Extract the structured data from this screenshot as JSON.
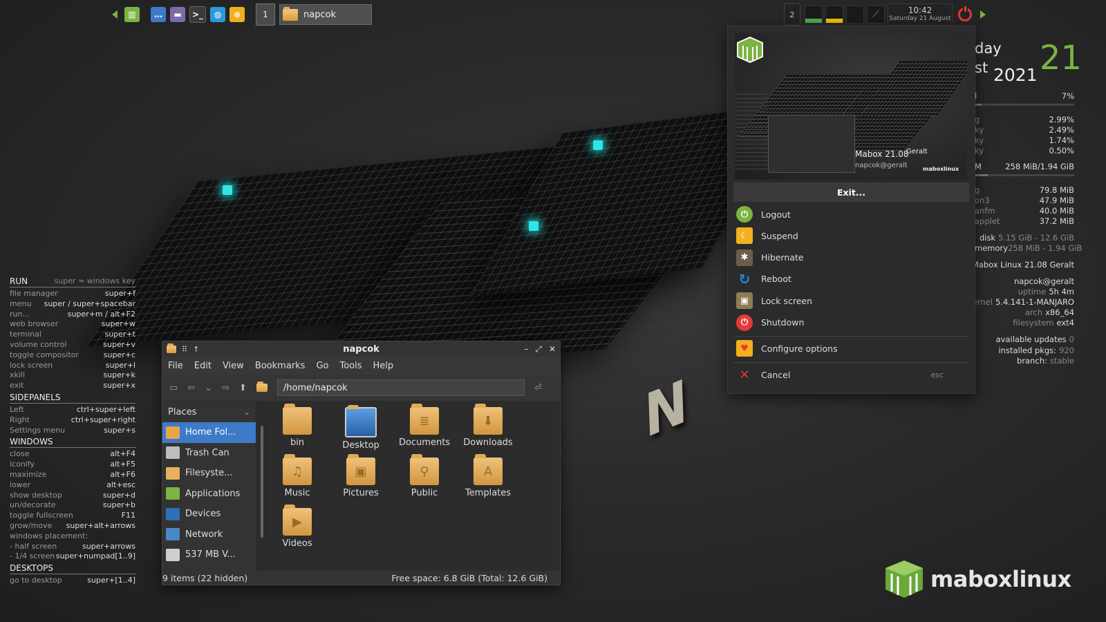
{
  "panel": {
    "workspace_current": "1",
    "task_title": "napcok",
    "workspace_right": "2",
    "clock_time": "10:42",
    "clock_date": "Saturday 21 August"
  },
  "keybinds": {
    "run_header": "RUN",
    "run_sub": "super = windows key",
    "run": [
      {
        "label": "file manager",
        "key": "super+f"
      },
      {
        "label": "menu",
        "key": "super / super+spacebar"
      },
      {
        "label": "run...",
        "key": "super+m / alt+F2"
      },
      {
        "label": "web browser",
        "key": "super+w"
      },
      {
        "label": "terminal",
        "key": "super+t"
      },
      {
        "label": "volume control",
        "key": "super+v"
      },
      {
        "label": "toggle compositor",
        "key": "super+c"
      },
      {
        "label": "lock screen",
        "key": "super+l"
      },
      {
        "label": "xkill",
        "key": "super+k"
      },
      {
        "label": "exit",
        "key": "super+x"
      }
    ],
    "sidepanels_header": "SIDEPANELS",
    "sidepanels": [
      {
        "label": "Left",
        "key": "ctrl+super+left"
      },
      {
        "label": "Right",
        "key": "ctrl+super+right"
      },
      {
        "label": "Settings menu",
        "key": "super+s"
      }
    ],
    "windows_header": "WINDOWS",
    "windows": [
      {
        "label": "close",
        "key": "alt+F4"
      },
      {
        "label": "iconify",
        "key": "alt+F5"
      },
      {
        "label": "maximize",
        "key": "alt+F6"
      },
      {
        "label": "lower",
        "key": "alt+esc"
      },
      {
        "label": "show desktop",
        "key": "super+d"
      },
      {
        "label": "un/decorate",
        "key": "super+b"
      },
      {
        "label": "toggle fullscreen",
        "key": "F11"
      },
      {
        "label": "grow/move",
        "key": "super+alt+arrows"
      },
      {
        "label": "windows placement:",
        "key": ""
      },
      {
        "label": " - half screen",
        "key": "super+arrows"
      },
      {
        "label": " - 1/4 screen",
        "key": "super+numpad[1..9]"
      }
    ],
    "desktops_header": "DESKTOPS",
    "desktops": [
      {
        "label": "go to desktop",
        "key": "super+[1..4]"
      }
    ]
  },
  "file_manager": {
    "title": "napcok",
    "menu": [
      "File",
      "Edit",
      "View",
      "Bookmarks",
      "Go",
      "Tools",
      "Help"
    ],
    "path": "/home/napcok",
    "places_label": "Places",
    "places": [
      {
        "label": "Home Fol...",
        "icon": "home-folder-icon",
        "color": "#e8a64a",
        "selected": true
      },
      {
        "label": "Trash Can",
        "icon": "trash-icon",
        "color": "#bdbdbd",
        "selected": false
      },
      {
        "label": "Filesyste...",
        "icon": "folder-icon",
        "color": "#e8b25c",
        "selected": false
      },
      {
        "label": "Applications",
        "icon": "applications-icon",
        "color": "#7cb342",
        "selected": false
      },
      {
        "label": "Devices",
        "icon": "monitor-icon",
        "color": "#2f6fb8",
        "selected": false
      },
      {
        "label": "Network",
        "icon": "network-icon",
        "color": "#4a86c8",
        "selected": false
      },
      {
        "label": "537 MB V...",
        "icon": "drive-icon",
        "color": "#cfcfcf",
        "selected": false
      }
    ],
    "files": [
      {
        "name": "bin",
        "icon": "folder-icon",
        "glyph": ""
      },
      {
        "name": "Desktop",
        "icon": "desktop-folder-icon",
        "glyph": ""
      },
      {
        "name": "Documents",
        "icon": "documents-folder-icon",
        "glyph": "≣"
      },
      {
        "name": "Downloads",
        "icon": "downloads-folder-icon",
        "glyph": "⬇"
      },
      {
        "name": "Music",
        "icon": "music-folder-icon",
        "glyph": "♫"
      },
      {
        "name": "Pictures",
        "icon": "pictures-folder-icon",
        "glyph": "▣"
      },
      {
        "name": "Public",
        "icon": "public-folder-icon",
        "glyph": "⚲"
      },
      {
        "name": "Templates",
        "icon": "templates-folder-icon",
        "glyph": "A"
      },
      {
        "name": "Videos",
        "icon": "videos-folder-icon",
        "glyph": "▶"
      }
    ],
    "status_items": "9 items (22 hidden)",
    "status_free": "Free space: 6.8 GiB (Total: 12.6 GiB)"
  },
  "exit_dialog": {
    "preview_name": "Mabox 21.08",
    "preview_codename": "Geralt",
    "preview_user": "napcok@geralt",
    "preview_brand": "maboxlinux",
    "exit_label": "Exit...",
    "options": [
      {
        "label": "Logout",
        "icon": "logout-icon",
        "color": "#7cb342",
        "glyph": "⏻"
      },
      {
        "label": "Suspend",
        "icon": "suspend-icon",
        "color": "#f2b01e",
        "glyph": "☾"
      },
      {
        "label": "Hibernate",
        "icon": "hibernate-icon",
        "color": "#6d5d4f",
        "glyph": "✱"
      },
      {
        "label": "Reboot",
        "icon": "reboot-icon",
        "color": "#1e88e5",
        "glyph": "↻"
      },
      {
        "label": "Lock screen",
        "icon": "lock-icon",
        "color": "#8a7d55",
        "glyph": "▣"
      },
      {
        "label": "Shutdown",
        "icon": "shutdown-icon",
        "color": "#e53935",
        "glyph": "⏻"
      }
    ],
    "configure_label": "Configure options",
    "cancel_label": "Cancel",
    "cancel_key": "esc"
  },
  "conky": {
    "day_partial": "day",
    "month_partial": "st",
    "year": "2021",
    "day_num": "21",
    "cpu_pct": "7%",
    "cpu_pct_value": 0.07,
    "procs_cpu": [
      {
        "name": "g",
        "val": "2.99%"
      },
      {
        "name": "ky",
        "val": "2.49%"
      },
      {
        "name": "ky",
        "val": "1.74%"
      },
      {
        "name": "ky",
        "val": "0.50%"
      }
    ],
    "mem_label": "M",
    "mem_val": "258 MiB/1.94 GiB",
    "mem_fraction": 0.13,
    "procs_mem": [
      {
        "name": "g",
        "val": "79.8 MiB"
      },
      {
        "name": "on3",
        "val": "47.9 MiB"
      },
      {
        "name": "anfm",
        "val": "40.0 MiB"
      },
      {
        "name": "applet",
        "val": "37.2 MiB"
      }
    ],
    "disk_label": "disk",
    "disk_val": "5.15 GiB - 12.6 GiB",
    "memory_label": "memory",
    "memory_val": "258 MiB - 1.94 GiB",
    "distro": "Mabox Linux 21.08 Geralt",
    "userhost": "napcok@geralt",
    "uptime_label": "uptime",
    "uptime_val": "5h 4m",
    "kernel_label": "kernel",
    "kernel_val": "5.4.141-1-MANJARO",
    "arch_label": "arch",
    "arch_val": "x86_64",
    "fs_label": "filesystem",
    "fs_val": "ext4",
    "updates_label": "available updates",
    "updates_val": "0",
    "pkgs_label": "installed pkgs:",
    "pkgs_val": "920",
    "branch_label": "branch:",
    "branch_val": "stable"
  },
  "brand": {
    "text": "maboxlinux"
  },
  "colors": {
    "accent_green": "#7cb342",
    "selection_blue": "#3d7bc8",
    "danger_red": "#e53935"
  }
}
